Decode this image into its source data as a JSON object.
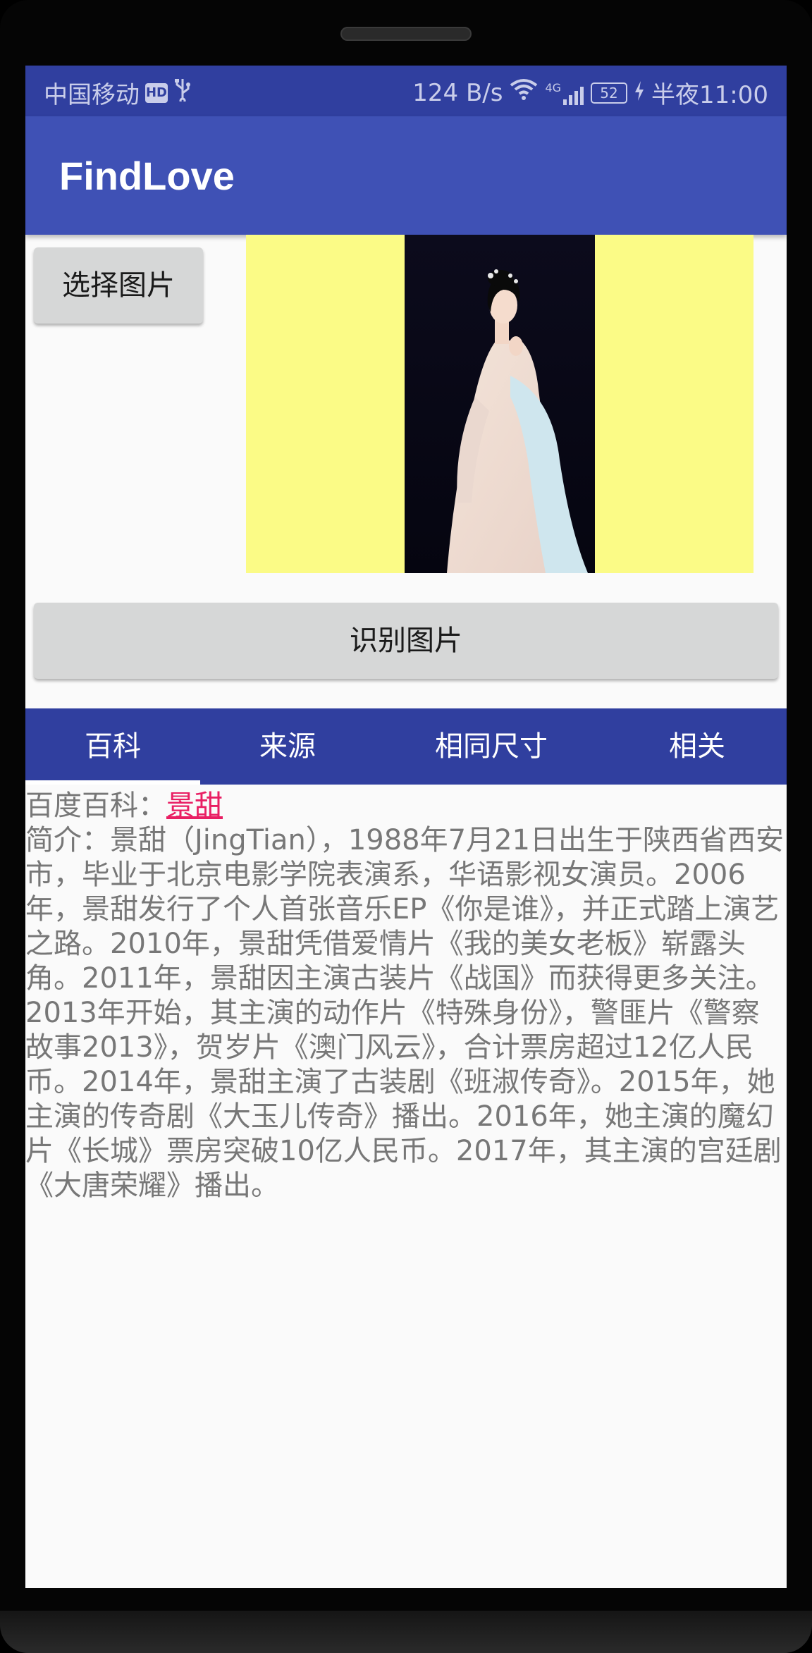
{
  "status_bar": {
    "carrier": "中国移动",
    "hd": "HD",
    "speed": "124 B/s",
    "network": "4G",
    "battery": "52",
    "time": "半夜11:00"
  },
  "app_bar": {
    "title": "FindLove"
  },
  "buttons": {
    "select_image": "选择图片",
    "recognize_image": "识别图片"
  },
  "tabs": [
    {
      "label": "百科",
      "selected": true
    },
    {
      "label": "来源",
      "selected": false
    },
    {
      "label": "相同尺寸",
      "selected": false
    },
    {
      "label": "相关",
      "selected": false
    }
  ],
  "content": {
    "baike_prefix": "百度百科：",
    "baike_link": "景甜",
    "intro": "简介：景甜（JingTian），1988年7月21日出生于陕西省西安市，毕业于北京电影学院表演系，华语影视女演员。2006年，景甜发行了个人首张音乐EP《你是谁》，并正式踏上演艺之路。2010年，景甜凭借爱情片《我的美女老板》崭露头角。2011年，景甜因主演古装片《战国》而获得更多关注。2013年开始，其主演的动作片《特殊身份》，警匪片《警察故事2013》，贺岁片《澳门风云》，合计票房超过12亿人民币。2014年，景甜主演了古装剧《班淑传奇》。2015年，她主演的传奇剧《大玉儿传奇》播出。2016年，她主演的魔幻片《长城》票房突破10亿人民币。2017年，其主演的宫廷剧《大唐荣耀》播出。"
  },
  "colors": {
    "status_bar": "#303f9f",
    "app_bar": "#3f51b5",
    "tab_bar": "#303f9f",
    "preview_bg": "#fbfb86",
    "link": "#e91e63"
  }
}
